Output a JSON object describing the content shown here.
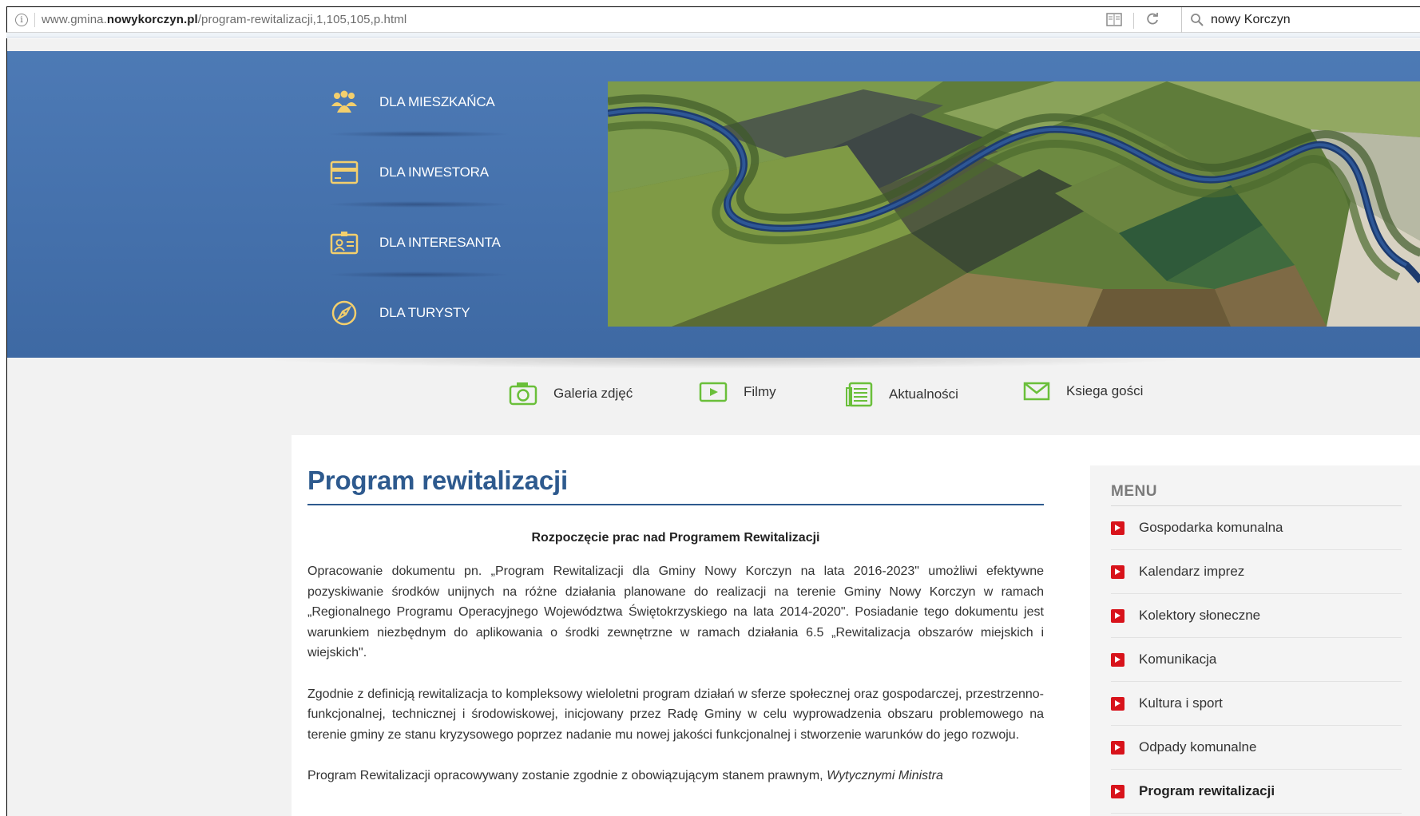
{
  "browser": {
    "url_prefix": "www.gmina.",
    "url_domain": "nowykorczyn.pl",
    "url_path": "/program-rewitalizacji,1,105,105,p.html",
    "search_text": "nowy Korczyn"
  },
  "hero": {
    "nav": [
      {
        "label": "DLA MIESZKAŃCA",
        "icon": "people-icon"
      },
      {
        "label": "DLA INWESTORA",
        "icon": "card-icon"
      },
      {
        "label": "DLA INTERESANTA",
        "icon": "id-card-icon"
      },
      {
        "label": "DLA TURYSTY",
        "icon": "compass-icon"
      }
    ]
  },
  "quick_links": [
    {
      "label": "Galeria zdjęć",
      "icon": "camera-icon"
    },
    {
      "label": "Filmy",
      "icon": "play-icon"
    },
    {
      "label": "Aktualności",
      "icon": "newspaper-icon"
    },
    {
      "label": "Ksiega gości",
      "icon": "envelope-icon"
    }
  ],
  "article": {
    "title": "Program rewitalizacji",
    "subtitle": "Rozpoczęcie prac nad Programem Rewitalizacji",
    "p1": "Opracowanie dokumentu pn. „Program Rewitalizacji dla Gminy Nowy Korczyn na lata 2016-2023\" umożliwi efektywne pozyskiwanie środków unijnych na różne działania planowane do realizacji na terenie Gminy Nowy Korczyn w ramach „Regionalnego Programu Operacyjnego Województwa Świętokrzyskiego na lata 2014-2020\". Posiadanie tego dokumentu jest warunkiem niezbędnym do aplikowania o środki zewnętrzne w ramach działania 6.5 „Rewitalizacja obszarów miejskich i wiejskich\".",
    "p2": "Zgodnie z definicją rewitalizacja to kompleksowy wieloletni program działań w sferze społecznej oraz gospodarczej, przestrzenno-funkcjonalnej, technicznej i środowiskowej, inicjowany przez Radę Gminy w celu wyprowadzenia obszaru problemowego na terenie gminy ze stanu kryzysowego poprzez nadanie mu nowej jakości funkcjonalnej i stworzenie warunków do jego rozwoju.",
    "p3_start": "Program Rewitalizacji opracowywany zostanie zgodnie z obowiązującym stanem prawnym, ",
    "p3_italic": "Wytycznymi Ministra"
  },
  "sidebar": {
    "heading": "MENU",
    "items": [
      {
        "label": "Gospodarka komunalna"
      },
      {
        "label": "Kalendarz imprez"
      },
      {
        "label": "Kolektory słoneczne"
      },
      {
        "label": "Komunikacja"
      },
      {
        "label": "Kultura i sport"
      },
      {
        "label": "Odpady komunalne"
      },
      {
        "label": "Program rewitalizacji"
      }
    ]
  },
  "colors": {
    "hero_blue": "#4470ab",
    "title_blue": "#2e5a8e",
    "menu_arrow_red": "#d8131b",
    "quick_icon_green": "#6abf3a"
  }
}
